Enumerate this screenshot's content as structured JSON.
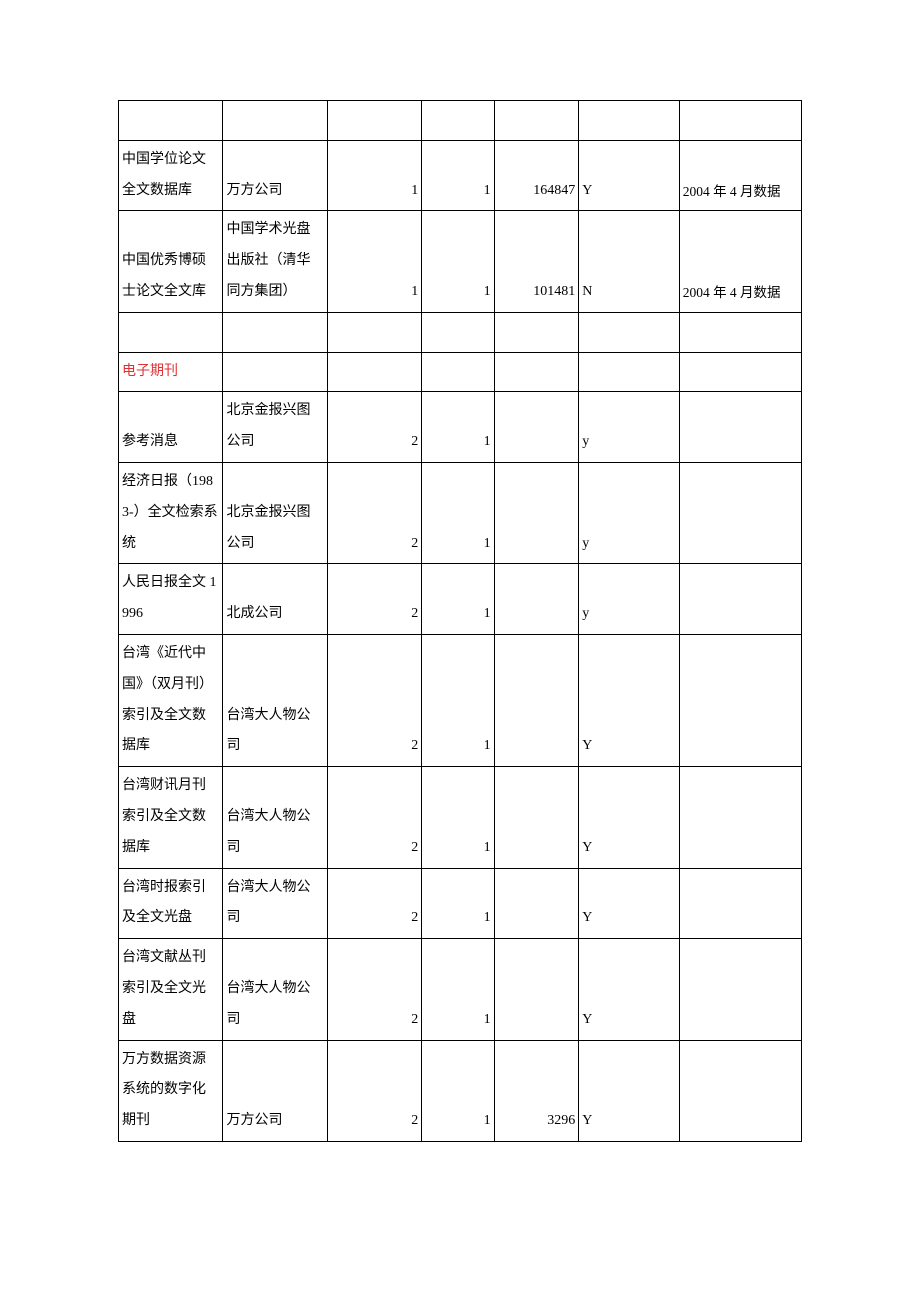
{
  "rows": [
    {
      "c1": "",
      "c2": "",
      "c3": "",
      "c4": "",
      "c5": "",
      "c6": "",
      "c7": ""
    },
    {
      "c1": "中国学位论文全文数据库",
      "c2": "万方公司",
      "c3": "1",
      "c4": "1",
      "c5": "164847",
      "c6": "Y",
      "c7": "2004 年 4 月数据"
    },
    {
      "c1": "中国优秀博硕士论文全文库",
      "c2": "中国学术光盘出版社（清华同方集团）",
      "c3": "1",
      "c4": "1",
      "c5": "101481",
      "c6": " N",
      "c7": "2004 年 4 月数据"
    },
    {
      "c1": "",
      "c2": "",
      "c3": "",
      "c4": "",
      "c5": "",
      "c6": "",
      "c7": ""
    },
    {
      "c1": "电子期刊",
      "c2": "",
      "c3": "",
      "c4": "",
      "c5": "",
      "c6": "",
      "c7": "",
      "red": true
    },
    {
      "c1": "参考消息",
      "c2": "北京金报兴图公司",
      "c3": "2",
      "c4": "1",
      "c5": "",
      "c6": "y",
      "c7": ""
    },
    {
      "c1": "经济日报（1983-）全文检索系统",
      "c2": "北京金报兴图公司",
      "c3": "2",
      "c4": "1",
      "c5": "",
      "c6": "y",
      "c7": ""
    },
    {
      "c1": "人民日报全文 1996",
      "c2": "北成公司",
      "c3": "2",
      "c4": "1",
      "c5": "",
      "c6": "y",
      "c7": ""
    },
    {
      "c1": "台湾《近代中国》（双月刊）索引及全文数据库",
      "c2": "台湾大人物公司",
      "c3": "2",
      "c4": "1",
      "c5": "",
      "c6": "Y",
      "c7": ""
    },
    {
      "c1": "台湾财讯月刊索引及全文数据库",
      "c2": "台湾大人物公司",
      "c3": "2",
      "c4": "1",
      "c5": "",
      "c6": "Y",
      "c7": ""
    },
    {
      "c1": "台湾时报索引及全文光盘",
      "c2": "台湾大人物公司",
      "c3": "2",
      "c4": "1",
      "c5": "",
      "c6": "Y",
      "c7": ""
    },
    {
      "c1": "台湾文献丛刊索引及全文光盘",
      "c2": "台湾大人物公司",
      "c3": "2",
      "c4": "1",
      "c5": "",
      "c6": "Y",
      "c7": ""
    },
    {
      "c1": "万方数据资源系统的数字化期刊",
      "c2": "万方公司",
      "c3": "2",
      "c4": "1",
      "c5": "3296",
      "c6": "Y",
      "c7": ""
    }
  ]
}
